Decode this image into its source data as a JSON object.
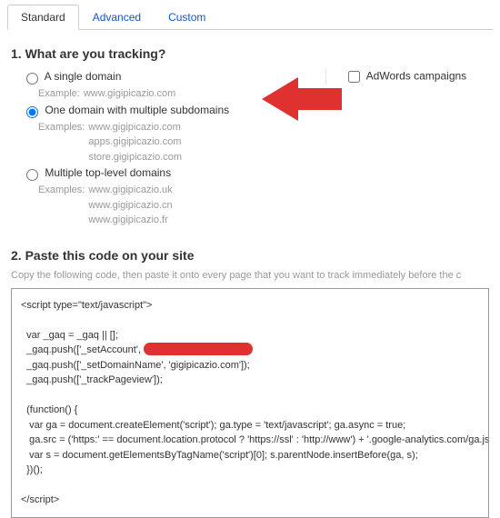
{
  "tabs": {
    "standard": "Standard",
    "advanced": "Advanced",
    "custom": "Custom"
  },
  "q1": {
    "heading": "1. What are you tracking?",
    "opt_single": {
      "label": "A single domain",
      "example_label": "Example:",
      "example": "www.gigipicazio.com"
    },
    "opt_sub": {
      "label": "One domain with multiple subdomains",
      "examples_label": "Examples:",
      "examples": [
        "www.gigipicazio.com",
        "apps.gigipicazio.com",
        "store.gigipicazio.com"
      ]
    },
    "opt_tld": {
      "label": "Multiple top-level domains",
      "examples_label": "Examples:",
      "examples": [
        "www.gigipicazio.uk",
        "www.gigipicazio.cn",
        "www.gigipicazio.fr"
      ]
    }
  },
  "side": {
    "adwords": "AdWords campaigns"
  },
  "q2": {
    "heading": "2. Paste this code on your site",
    "sub": "Copy the following code, then paste it onto every page that you want to track immediately before the c",
    "l1": "<script type=\"text/javascript\">",
    "l2": "  var _gaq = _gaq || [];",
    "l3a": "  _gaq.push(['_setAccount',",
    "l4": "  _gaq.push(['_setDomainName', 'gigipicazio.com']);",
    "l5": "  _gaq.push(['_trackPageview']);",
    "l6": "  (function() {",
    "l7": "   var ga = document.createElement('script'); ga.type = 'text/javascript'; ga.async = true;",
    "l8": "   ga.src = ('https:' == document.location.protocol ? 'https://ssl' : 'http://www') + '.google-analytics.com/ga.js';",
    "l9": "   var s = document.getElementsByTagName('script')[0]; s.parentNode.insertBefore(ga, s);",
    "l10": "  })();",
    "l11": "</script>"
  }
}
